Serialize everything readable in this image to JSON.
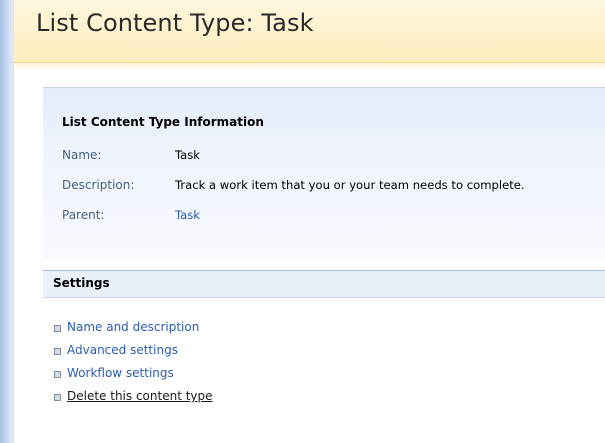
{
  "page": {
    "title": "List Content Type: Task"
  },
  "info": {
    "heading": "List Content Type Information",
    "rows": [
      {
        "label": "Name:",
        "value": "Task"
      },
      {
        "label": "Description:",
        "value": "Track a work item that you or your team needs to complete."
      },
      {
        "label": "Parent:",
        "value": "Task"
      }
    ]
  },
  "settings": {
    "title": "Settings",
    "items": [
      {
        "label": "Name and description"
      },
      {
        "label": "Advanced settings"
      },
      {
        "label": "Workflow settings"
      },
      {
        "label": "Delete this content type"
      }
    ]
  },
  "colors": {
    "title_band": "#fdeebe",
    "panel_background": "#eef3fc",
    "link": "#2a5db0",
    "label": "#47607f"
  },
  "icons": {
    "bullet": "square-bullet-icon"
  }
}
